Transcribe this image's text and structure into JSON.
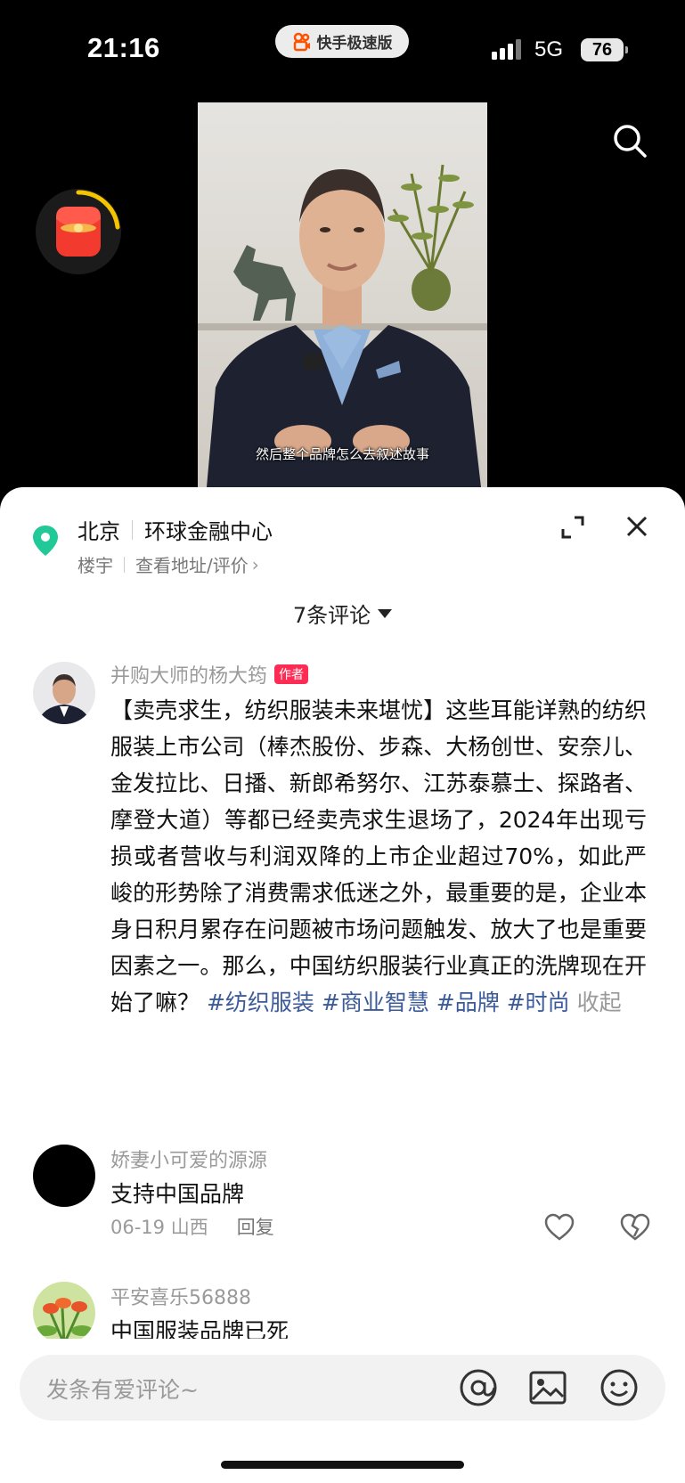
{
  "status_bar": {
    "time": "21:16",
    "app_name": "快手极速版",
    "network": "5G",
    "battery": "76"
  },
  "video": {
    "subtitle": "然后整个品牌怎么去叙述故事"
  },
  "location": {
    "city": "北京",
    "place": "环球金融中心",
    "category": "楼宇",
    "link": "查看地址/评价",
    "chevron": "›"
  },
  "comments_header": {
    "count_label": "7条评论"
  },
  "author_comment": {
    "name": "并购大师的杨大筠",
    "badge": "作者",
    "text": "【卖壳求生，纺织服装未来堪忧】这些耳能详熟的纺织服装上市公司（棒杰股份、步森、大杨创世、安奈儿、金发拉比、日播、新郎希努尔、江苏泰慕士、探路者、摩登大道）等都已经卖壳求生退场了，2024年出现亏损或者营收与利润双降的上市企业超过70%，如此严峻的形势除了消费需求低迷之外，最重要的是，企业本身日积月累存在问题被市场问题触发、放大了也是重要因素之一。那么，中国纺织服装行业真正的洗牌现在开始了嘛？",
    "hashtags": [
      "#纺织服装",
      "#商业智慧",
      "#品牌",
      "#时尚"
    ],
    "collapse_label": "收起"
  },
  "comments": [
    {
      "name": "娇妻小可爱的源源",
      "text": "支持中国品牌",
      "date": "06-19",
      "region": "山西",
      "reply_label": "回复"
    },
    {
      "name": "平安喜乐56888",
      "text": "中国服装品牌已死"
    }
  ],
  "input": {
    "placeholder": "发条有爱评论~"
  },
  "icons": {
    "search": "search-icon",
    "red_packet": "red-packet-icon",
    "location_pin": "location-pin-icon",
    "expand": "expand-icon",
    "close": "close-icon",
    "like": "heart-icon",
    "dislike": "broken-heart-icon",
    "mention": "at-icon",
    "image": "image-icon",
    "emoji": "emoji-icon"
  },
  "colors": {
    "accent_pink": "#fe2c55",
    "hashtag_blue": "#3a5a9a",
    "location_green": "#20c997"
  }
}
